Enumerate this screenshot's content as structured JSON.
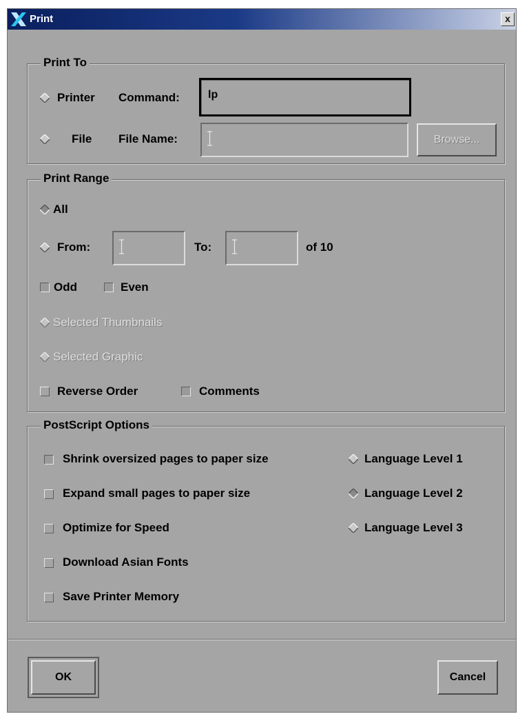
{
  "title": "Print",
  "close_label": "x",
  "print_to": {
    "group_title": "Print To",
    "printer_label": "Printer",
    "command_label": "Command:",
    "command_value": "lp",
    "file_label": "File",
    "file_name_label": "File Name:",
    "file_name_value": "",
    "browse_label": "Browse..."
  },
  "print_range": {
    "group_title": "Print Range",
    "all_label": "All",
    "from_label": "From:",
    "from_value": "",
    "to_label": "To:",
    "to_value": "",
    "of_label": "of 10",
    "odd_label": "Odd",
    "even_label": "Even",
    "selected_thumbnails_label": "Selected Thumbnails",
    "selected_graphic_label": "Selected Graphic",
    "reverse_order_label": "Reverse Order",
    "comments_label": "Comments"
  },
  "postscript": {
    "group_title": "PostScript Options",
    "shrink_label": "Shrink oversized pages to paper size",
    "expand_label": "Expand small pages to paper size",
    "optimize_label": "Optimize for Speed",
    "download_fonts_label": "Download Asian Fonts",
    "save_memory_label": "Save Printer Memory",
    "level1_label": "Language Level 1",
    "level2_label": "Language Level 2",
    "level3_label": "Language Level 3"
  },
  "buttons": {
    "ok_label": "OK",
    "cancel_label": "Cancel"
  }
}
